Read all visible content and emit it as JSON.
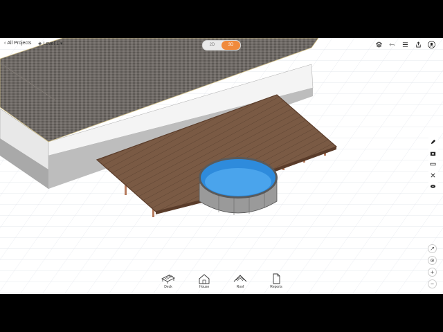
{
  "topbar": {
    "back_label": "All Projects",
    "level_label": "Level 1",
    "view_toggle": {
      "option_2d": "2D",
      "option_3d": "3D",
      "active": "3D"
    }
  },
  "toolbar_icons": [
    "layers-icon",
    "undo-icon",
    "menu-icon",
    "share-icon",
    "user-icon"
  ],
  "side_tools": [
    "pencil-icon",
    "camera-icon",
    "ruler-icon",
    "scissors-icon",
    "eye-icon"
  ],
  "zoom_tools": [
    "fit-icon",
    "locate-icon",
    "zoom-in-icon",
    "zoom-out-icon"
  ],
  "bottom_tabs": [
    {
      "label": "Deck",
      "icon": "deck-icon"
    },
    {
      "label": "House",
      "icon": "house-icon"
    },
    {
      "label": "Roof",
      "icon": "roof-icon"
    },
    {
      "label": "Reports",
      "icon": "reports-icon"
    }
  ],
  "colors": {
    "accent": "#f08a3c",
    "deck": "#7a5a44",
    "roof": "#6f6a66",
    "pool_water": "#2e8bdc",
    "pool_wall": "#9a9a9a",
    "wall": "#efefef"
  }
}
